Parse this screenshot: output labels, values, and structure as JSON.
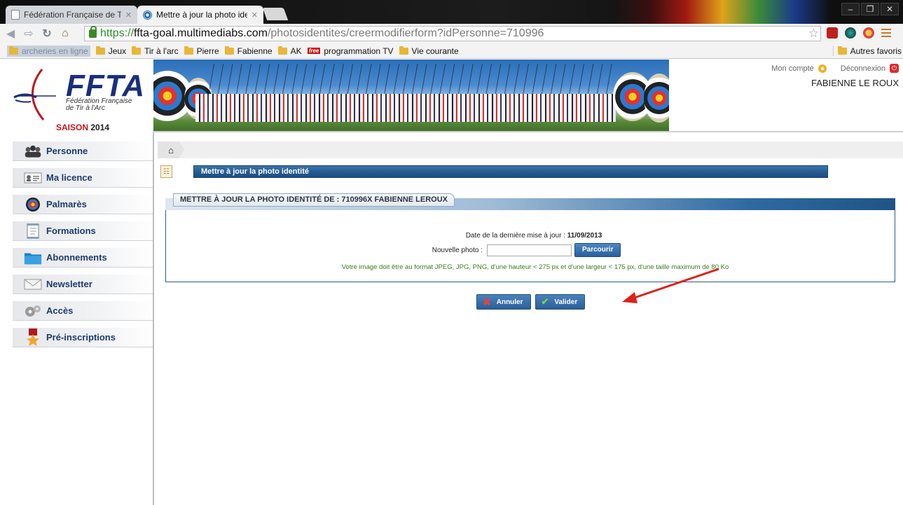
{
  "browser": {
    "tabs": [
      {
        "title": "Fédération Française de Ti"
      },
      {
        "title": "Mettre à jour la photo ide"
      }
    ],
    "url": {
      "scheme": "https://",
      "host": "ffta-goal.multimediabs.com",
      "path": "/photosidentites/creermodifierform?idPersonne=710996"
    },
    "bookmarks": [
      {
        "label": "archeries en ligne"
      },
      {
        "label": "Jeux"
      },
      {
        "label": "Tir à l'arc"
      },
      {
        "label": "Pierre"
      },
      {
        "label": "Fabienne"
      },
      {
        "label": "AK"
      },
      {
        "label": "programmation TV",
        "badge": "free"
      },
      {
        "label": "Vie courante"
      }
    ],
    "other_bookmarks": "Autres favoris"
  },
  "header": {
    "logo_word": "FFTA",
    "logo_sub_1": "Fédération Française",
    "logo_sub_2": "de Tir à l'Arc",
    "season_word": "SAISON",
    "season_year": "2014",
    "account_link": "Mon compte",
    "logout_link": "Déconnexion",
    "user_name": "FABIENNE LE ROUX"
  },
  "sidebar": {
    "items": [
      {
        "label": "Personne",
        "icon": "people-icon"
      },
      {
        "label": "Ma licence",
        "icon": "id-card-icon"
      },
      {
        "label": "Palmarès",
        "icon": "target-icon"
      },
      {
        "label": "Formations",
        "icon": "scroll-icon"
      },
      {
        "label": "Abonnements",
        "icon": "folder-icon"
      },
      {
        "label": "Newsletter",
        "icon": "envelope-icon"
      },
      {
        "label": "Accès",
        "icon": "gears-icon"
      },
      {
        "label": "Pré-inscriptions",
        "icon": "medal-icon"
      }
    ]
  },
  "main": {
    "title_bar": "Mettre à jour la photo identité",
    "panel_title": "METTRE À JOUR LA PHOTO IDENTITÉ DE : 710996X FABIENNE LEROUX",
    "date_label": "Date de la dernière mise à jour :",
    "date_value": "11/09/2013",
    "photo_label": "Nouvelle photo :",
    "browse_button": "Parcourir",
    "hint": "Votre image doit être au format JPEG, JPG, PNG, d'une hauteur < 275 px et d'une largeur < 175 px, d'une taille maximum de 80 Ko",
    "cancel_button": "Annuler",
    "validate_button": "Valider"
  },
  "colors": {
    "brand_blue": "#1a2e7a",
    "season_red": "#c0161b",
    "button_blue": "#2b5f98",
    "hint_green": "#3a7d1c",
    "annotation_red": "#e0201a"
  }
}
